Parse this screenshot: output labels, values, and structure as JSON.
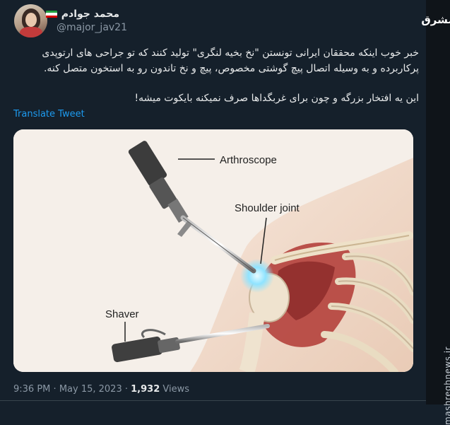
{
  "author": {
    "display_name": "محمد جوادم",
    "handle": "@major_jav21",
    "flag": "iran-flag-icon"
  },
  "tweet": {
    "paragraph_1": "خبر خوب اینکه محققان ایرانی تونستن \"نخ بخیه لنگری\" تولید کنند که تو جراحی های ارتوپدی پرکاربرده و به وسیله اتصال پیچ گوشتی مخصوص، پیچ و نخ تاندون رو به استخون متصل کنه.",
    "paragraph_2": "این یه افتخار بزرگه و چون برای غربگداها صرف نمیکنه بایکوت میشه!",
    "translate_label": "Translate Tweet"
  },
  "media": {
    "labels": {
      "arthroscope": "Arthroscope",
      "shoulder_joint": "Shoulder joint",
      "shaver": "Shaver"
    }
  },
  "meta": {
    "time": "9:36 PM",
    "separator": "·",
    "date": "May 15, 2023",
    "views_count": "1,932",
    "views_label": "Views"
  },
  "brand": {
    "logo_main": "مشرق",
    "logo_sub": "مشرق",
    "watermark": "mashreghnews.ir"
  },
  "colors": {
    "background": "#15202b",
    "link": "#1d9bf0",
    "muted": "#8b98a5"
  }
}
